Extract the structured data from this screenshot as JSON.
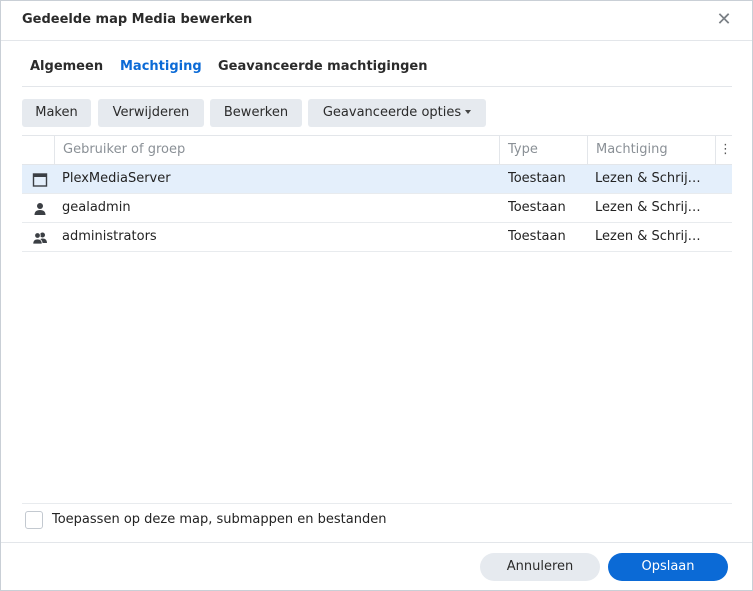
{
  "dialog": {
    "title": "Gedeelde map Media bewerken",
    "close_glyph": "✕"
  },
  "tabs": [
    {
      "label": "Algemeen",
      "active": false
    },
    {
      "label": "Machtiging",
      "active": true
    },
    {
      "label": "Geavanceerde machtigingen",
      "active": false
    }
  ],
  "toolbar": {
    "create_label": "Maken",
    "delete_label": "Verwijderen",
    "edit_label": "Bewerken",
    "advanced_label": "Geavanceerde opties"
  },
  "grid": {
    "columns": {
      "user": "Gebruiker of groep",
      "type": "Type",
      "permission": "Machtiging",
      "menu_glyph": "⋮"
    },
    "rows": [
      {
        "icon": "application-icon",
        "name": "PlexMediaServer",
        "type": "Toestaan",
        "permission": "Lezen & Schrij…",
        "selected": true
      },
      {
        "icon": "user-icon",
        "name": "gealadmin",
        "type": "Toestaan",
        "permission": "Lezen & Schrij…",
        "selected": false
      },
      {
        "icon": "group-icon",
        "name": "administrators",
        "type": "Toestaan",
        "permission": "Lezen & Schrij…",
        "selected": false
      }
    ]
  },
  "apply_checkbox": {
    "label": "Toepassen op deze map, submappen en bestanden",
    "checked": false
  },
  "footer": {
    "cancel_label": "Annuleren",
    "save_label": "Opslaan"
  },
  "colors": {
    "accent": "#0b6ad6",
    "selected_row": "#e4effb",
    "button_bg": "#e6eaef"
  }
}
